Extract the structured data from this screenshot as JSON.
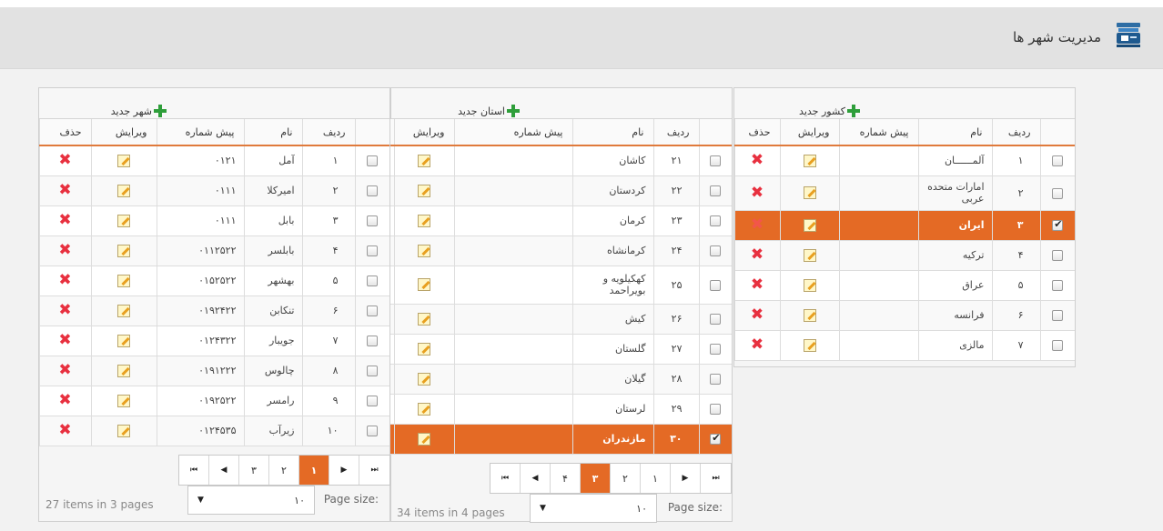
{
  "header": {
    "title": "مدیریت شهر ها"
  },
  "columns": {
    "row": "ردیف",
    "name": "نام",
    "prefix": "پیش شماره",
    "edit": "ویرایش",
    "delete": "حذف"
  },
  "countries": {
    "add_label": "کشور جدید",
    "rows": [
      {
        "num": "۱",
        "name": "آلمــــــان",
        "prefix": "",
        "checked": false
      },
      {
        "num": "۲",
        "name": "امارات متحده عربی",
        "prefix": "",
        "checked": false
      },
      {
        "num": "۳",
        "name": "ایران",
        "prefix": "",
        "checked": true
      },
      {
        "num": "۴",
        "name": "ترکیه",
        "prefix": "",
        "checked": false
      },
      {
        "num": "۵",
        "name": "عراق",
        "prefix": "",
        "checked": false
      },
      {
        "num": "۶",
        "name": "فرانسه",
        "prefix": "",
        "checked": false
      },
      {
        "num": "۷",
        "name": "مالزی",
        "prefix": "",
        "checked": false
      }
    ]
  },
  "provinces": {
    "add_label": "استان جدید",
    "rows": [
      {
        "num": "۲۱",
        "name": "کاشان",
        "prefix": "",
        "checked": false
      },
      {
        "num": "۲۲",
        "name": "کردستان",
        "prefix": "",
        "checked": false
      },
      {
        "num": "۲۳",
        "name": "کرمان",
        "prefix": "",
        "checked": false
      },
      {
        "num": "۲۴",
        "name": "کرمانشاه",
        "prefix": "",
        "checked": false
      },
      {
        "num": "۲۵",
        "name": "کهکیلویه و بویراحمد",
        "prefix": "",
        "checked": false
      },
      {
        "num": "۲۶",
        "name": "کیش",
        "prefix": "",
        "checked": false
      },
      {
        "num": "۲۷",
        "name": "گلستان",
        "prefix": "",
        "checked": false
      },
      {
        "num": "۲۸",
        "name": "گیلان",
        "prefix": "",
        "checked": false
      },
      {
        "num": "۲۹",
        "name": "لرستان",
        "prefix": "",
        "checked": false
      },
      {
        "num": "۳۰",
        "name": "مازندران",
        "prefix": "",
        "checked": true
      }
    ],
    "pages": [
      "۴",
      "۳",
      "۲",
      "۱"
    ],
    "current_page": "۳",
    "page_size_label": "Page size:",
    "page_size": "۱۰",
    "items_info": "34 items in 4 pages"
  },
  "cities": {
    "add_label": "شهر جدید",
    "rows": [
      {
        "num": "۱",
        "name": "آمل",
        "prefix": "۰۱۲۱",
        "checked": false
      },
      {
        "num": "۲",
        "name": "امیرکلا",
        "prefix": "۰۱۱۱",
        "checked": false
      },
      {
        "num": "۳",
        "name": "بابل",
        "prefix": "۰۱۱۱",
        "checked": false
      },
      {
        "num": "۴",
        "name": "بابلسر",
        "prefix": "۰۱۱۲۵۲۲",
        "checked": false
      },
      {
        "num": "۵",
        "name": "بهشهر",
        "prefix": "۰۱۵۲۵۲۲",
        "checked": false
      },
      {
        "num": "۶",
        "name": "تنکابن",
        "prefix": "۰۱۹۲۴۲۲",
        "checked": false
      },
      {
        "num": "۷",
        "name": "جویبار",
        "prefix": "۰۱۲۴۳۲۲",
        "checked": false
      },
      {
        "num": "۸",
        "name": "چالوس",
        "prefix": "۰۱۹۱۲۲۲",
        "checked": false
      },
      {
        "num": "۹",
        "name": "رامسر",
        "prefix": "۰۱۹۲۵۲۲",
        "checked": false
      },
      {
        "num": "۱۰",
        "name": "زیرآب",
        "prefix": "۰۱۲۴۵۳۵",
        "checked": false
      }
    ],
    "pages": [
      "۳",
      "۲",
      "۱"
    ],
    "current_page": "۱",
    "page_size_label": "Page size:",
    "page_size": "۱۰",
    "items_info": "27 items in 3 pages"
  },
  "colors": {
    "accent": "#e46a25",
    "add": "#2e9e3a",
    "delete": "#e8303f"
  },
  "icons": {
    "add": "plus-icon",
    "edit": "edit-icon",
    "delete": "delete-icon",
    "first": "first-page-icon",
    "prev": "prev-page-icon",
    "next": "next-page-icon",
    "last": "last-page-icon"
  }
}
